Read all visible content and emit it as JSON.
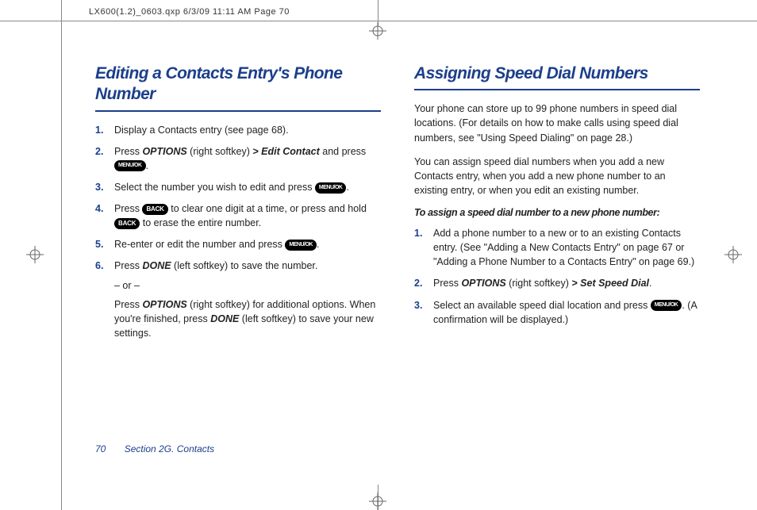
{
  "print_header": "LX600(1.2)_0603.qxp  6/3/09  11:11 AM  Page 70",
  "left": {
    "heading": "Editing a Contacts Entry's Phone Number",
    "steps": {
      "s1": "Display a Contacts entry (see page 68).",
      "s2a": "Press ",
      "s2_opt": "OPTIONS",
      "s2b": " (right softkey) ",
      "gt": ">",
      "s2_edit": "Edit Contact",
      "s2c": " and press ",
      "s3a": "Select the number you wish to edit and press ",
      "s4a": "Press ",
      "s4b": " to clear one digit at a time, or press and hold ",
      "s4c": " to erase the entire number.",
      "s5a": "Re-enter or edit the number and press ",
      "s6a": "Press ",
      "s6_done": "DONE",
      "s6b": " (left softkey) to save the number.",
      "s6_or": "– or –",
      "s6c": "Press ",
      "s6d": " (right softkey) for additional options. When you're finished, press ",
      "s6e": " (left softkey) to save your new settings."
    },
    "keys": {
      "menu": "MENU/OK",
      "back": "BACK"
    }
  },
  "right": {
    "heading": "Assigning Speed Dial Numbers",
    "p1": "Your phone can store up to 99 phone numbers in speed dial locations. (For details on how to make calls using speed dial numbers, see \"Using Speed Dialing\" on page 28.)",
    "p2": "You can assign speed dial numbers when you add a new Contacts entry, when you add a new phone number to an existing entry, or when you edit an existing number.",
    "subhead": "To assign a speed dial number to a new phone number:",
    "steps": {
      "s1": "Add a phone number to a new or to an existing Contacts entry. (See \"Adding a New Contacts Entry\" on page 67 or \"Adding a Phone Number to a Contacts Entry\" on page 69.)",
      "s2a": "Press ",
      "s2_opt": "OPTIONS",
      "s2b": " (right softkey) ",
      "gt": ">",
      "s2_ssd": "Set Speed Dial",
      "s3a": "Select an available speed dial location and press ",
      "s3b": ". (A confirmation will be displayed.)"
    }
  },
  "footer": {
    "page": "70",
    "section": "Section 2G. Contacts"
  }
}
